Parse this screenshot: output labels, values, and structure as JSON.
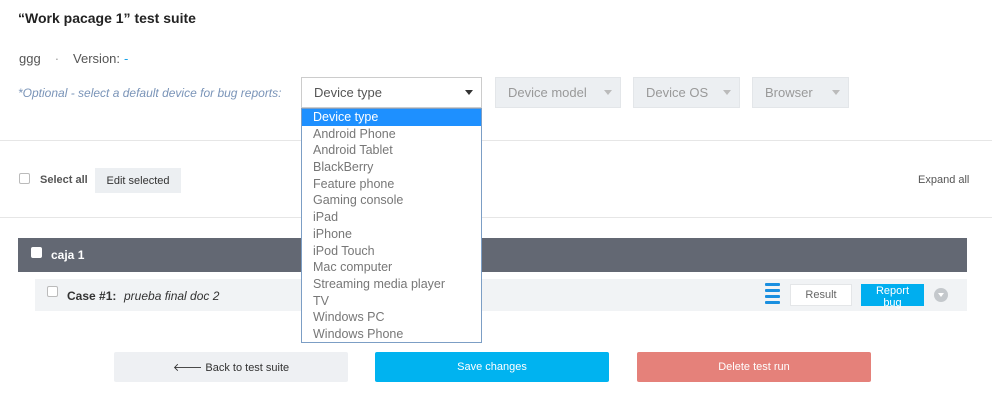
{
  "header": {
    "title": "“Work pacage 1” test suite"
  },
  "meta": {
    "project": "ggg",
    "version_label": "Version:",
    "version_value": "-"
  },
  "device": {
    "optional_label": "*Optional - select a default device for bug reports:",
    "selected": "Device type",
    "disabled": {
      "model": "Device model",
      "os": "Device OS",
      "browser": "Browser"
    },
    "options": [
      "Device type",
      "Android Phone",
      "Android Tablet",
      "BlackBerry",
      "Feature phone",
      "Gaming console",
      "iPad",
      "iPhone",
      "iPod Touch",
      "Mac computer",
      "Streaming media player",
      "TV",
      "Windows PC",
      "Windows Phone"
    ]
  },
  "toolbar": {
    "select_all": "Select all",
    "edit_selected": "Edit selected",
    "expand_all": "Expand all"
  },
  "group": {
    "label": "caja 1"
  },
  "case": {
    "number": "Case #1:",
    "name": "prueba final doc 2",
    "result": "Result",
    "report_bug": "Report bug"
  },
  "actions": {
    "back": "Back to test suite",
    "save": "Save changes",
    "delete": "Delete test run"
  },
  "colors": {
    "accent": "#00b3f0",
    "danger": "#e5817a",
    "group_bg": "#636873",
    "selected_option": "#1e90ff"
  }
}
